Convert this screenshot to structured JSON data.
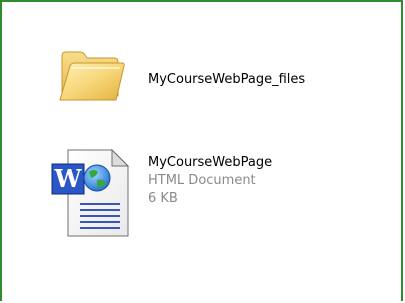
{
  "files": {
    "folder": {
      "name": "MyCourseWebPage_files",
      "icon": "folder-icon"
    },
    "document": {
      "name": "MyCourseWebPage",
      "type": "HTML Document",
      "size": "6 KB",
      "icon": "word-html-document-icon"
    }
  },
  "colors": {
    "frame_border": "#2e8b2e",
    "secondary_text": "#8a8a8a"
  }
}
